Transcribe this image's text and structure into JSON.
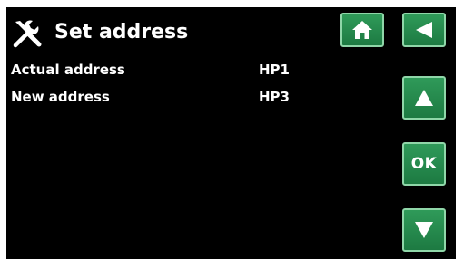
{
  "header": {
    "icon": "tools-icon",
    "title": "Set address"
  },
  "nav": {
    "home_icon": "home-icon",
    "back_icon": "back-arrow-icon"
  },
  "rows": [
    {
      "label": "Actual address",
      "value": "HP1"
    },
    {
      "label": "New address",
      "value": "HP3"
    }
  ],
  "controls": {
    "up_icon": "arrow-up-icon",
    "ok_label": "OK",
    "down_icon": "arrow-down-icon"
  },
  "colors": {
    "background": "#000000",
    "button_green": "#2a8f52",
    "button_border": "#8fd6a8",
    "text": "#ffffff"
  }
}
